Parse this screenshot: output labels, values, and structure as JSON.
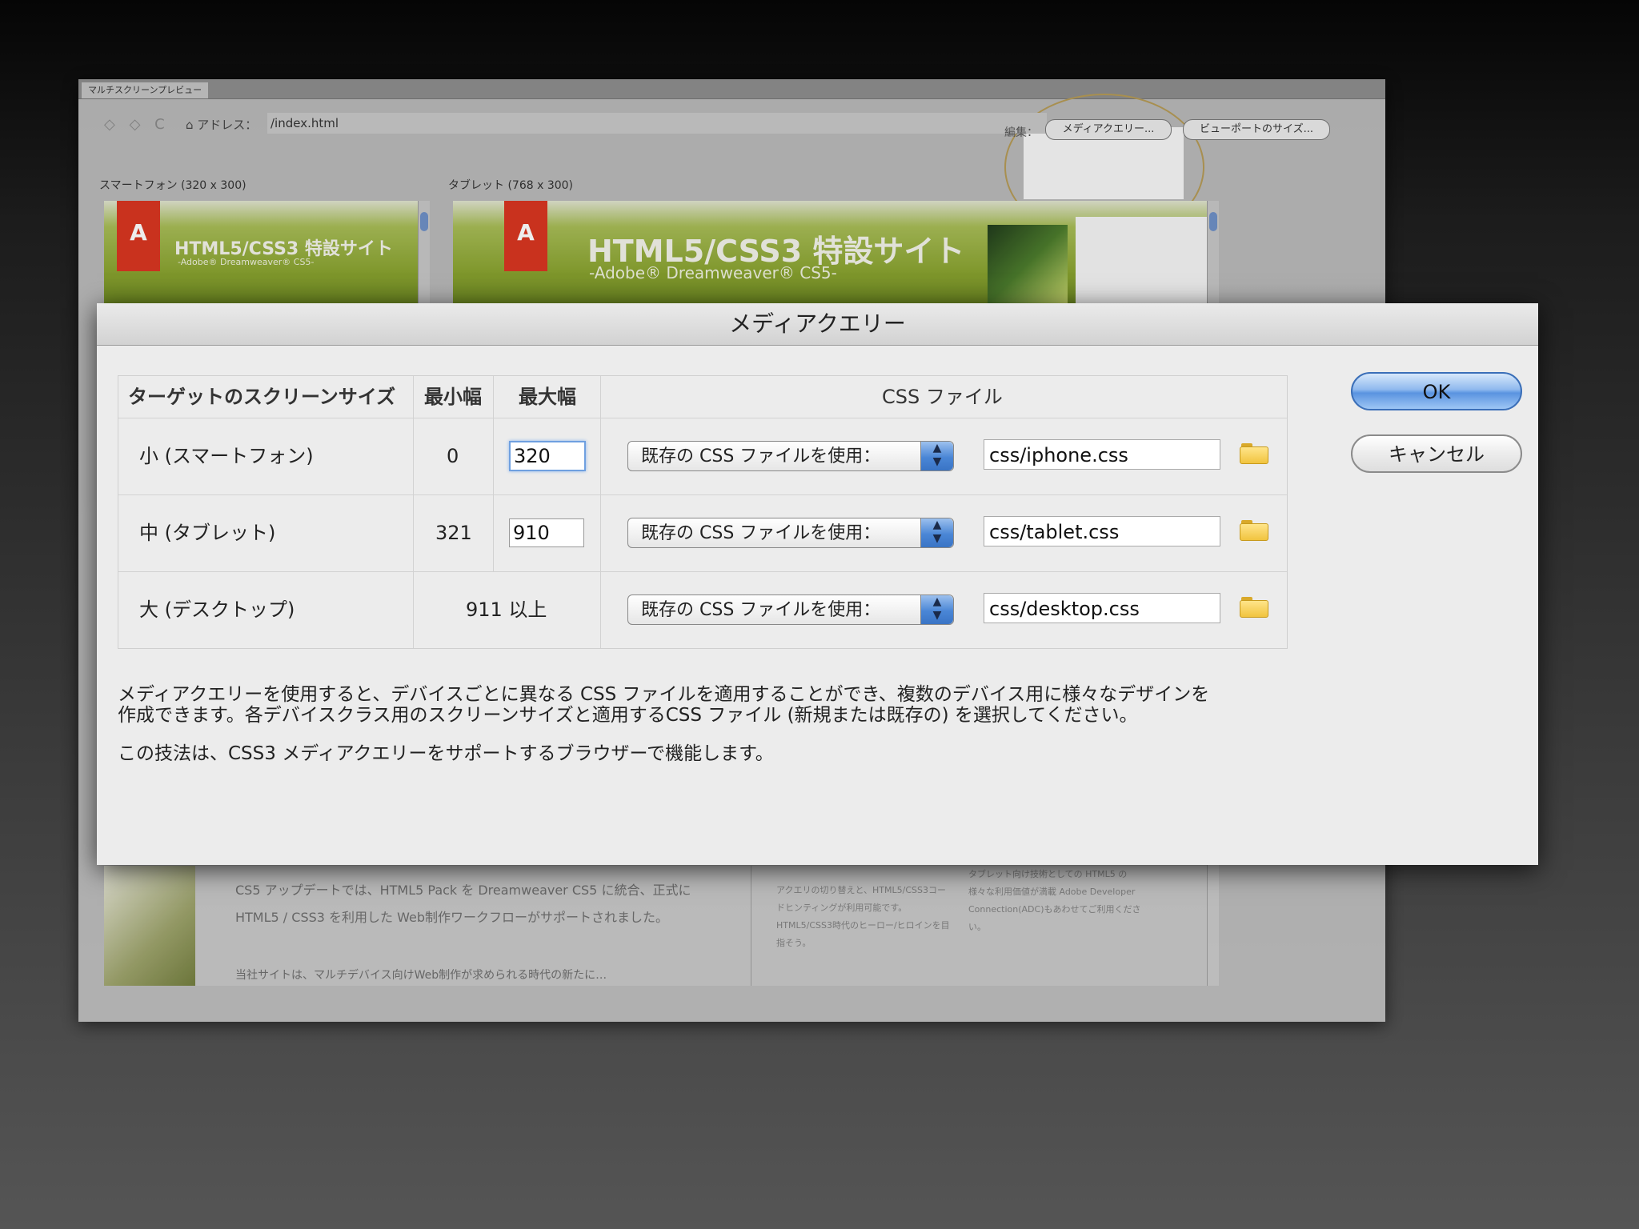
{
  "background_window": {
    "tab_label": "マルチスクリーンプレビュー",
    "nav_icons": "◇ ◇ C",
    "address_label": "⌂ アドレス：",
    "address_value": "/index.html",
    "display_label": "編集：",
    "media_query_button": "メディアクエリー...",
    "viewport_size_button": "ビューポートのサイズ...",
    "smartphone_pane_label": "スマートフォン (320 x 300)",
    "tablet_pane_label": "タブレット (768 x 300)",
    "banner_title": "HTML5/CSS3 特設サイト",
    "banner_subtitle": "-Adobe® Dreamweaver® CS5-",
    "logo_text": "A",
    "body_text": "CS5 アップデートでは、HTML5 Pack を Dreamweaver CS5 に統合、正式に HTML5 / CSS3 を利用した Web制作ワークフローがサポートされました。",
    "body_text_2": "当社サイトは、マルチデバイス向けWeb制作が求められる時代の新たに…",
    "col2_text": "アクエリの切り替えと、HTML5/CSS3コードヒンティングが利用可能です。 HTML5/CSS3時代のヒーロー/ヒロインを目指そう。",
    "col3_text": "タブレット向け技術としての HTML5 の様々な利用価値が満載 Adobe Developer Connection(ADC)もあわせてご利用ください。"
  },
  "dialog": {
    "title": "メディアクエリー",
    "headers": {
      "target": "ターゲットのスクリーンサイズ",
      "min": "最小幅",
      "max": "最大幅",
      "css": "CSS ファイル"
    },
    "rows": [
      {
        "label": "小 (スマートフォン)",
        "min": "0",
        "max": "320",
        "select": "既存の CSS ファイルを使用：",
        "file": "css/iphone.css"
      },
      {
        "label": "中 (タブレット)",
        "min": "321",
        "max": "910",
        "select": "既存の CSS ファイルを使用：",
        "file": "css/tablet.css"
      },
      {
        "label": "大 (デスクトップ)",
        "min_text": "911 以上",
        "select": "既存の CSS ファイルを使用：",
        "file": "css/desktop.css"
      }
    ],
    "description_line1": "メディアクエリーを使用すると、デバイスごとに異なる CSS ファイルを適用することができ、複数のデバイス用に様々なデザインを",
    "description_line2": "作成できます。各デバイスクラス用のスクリーンサイズと適用するCSS ファイル (新規または既存の) を選択してください。",
    "description_line3": "この技法は、CSS3 メディアクエリーをサポートするブラウザーで機能します。",
    "ok_label": "OK",
    "cancel_label": "キャンセル"
  },
  "colors": {
    "ok_button": "#5a93e0",
    "banner_green": "#88a22e",
    "adobe_red": "#d8341f",
    "highlight_ellipse": "#b59a55"
  }
}
